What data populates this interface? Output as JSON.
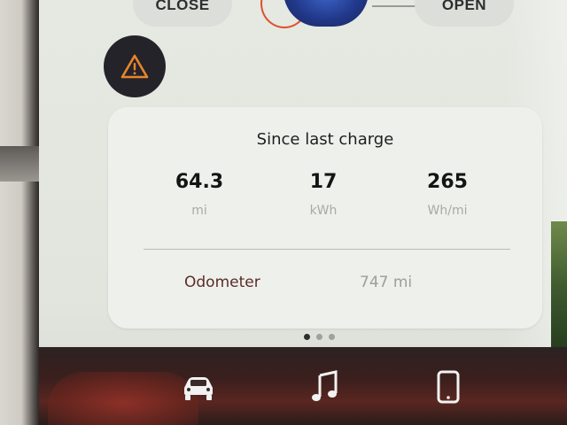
{
  "controls": {
    "left_label": "CLOSE",
    "right_label": "OPEN"
  },
  "alert": {
    "icon": "warning-icon",
    "color": "#e7862a"
  },
  "trip": {
    "title": "Since last charge",
    "stats": [
      {
        "value": "64.3",
        "unit": "mi"
      },
      {
        "value": "17",
        "unit": "kWh"
      },
      {
        "value": "265",
        "unit": "Wh/mi"
      }
    ],
    "odometer_label": "Odometer",
    "odometer_value": "747 mi"
  },
  "pager": {
    "count": 3,
    "active": 0
  },
  "dock": {
    "icons": [
      "car-icon",
      "music-icon",
      "phone-icon"
    ]
  }
}
